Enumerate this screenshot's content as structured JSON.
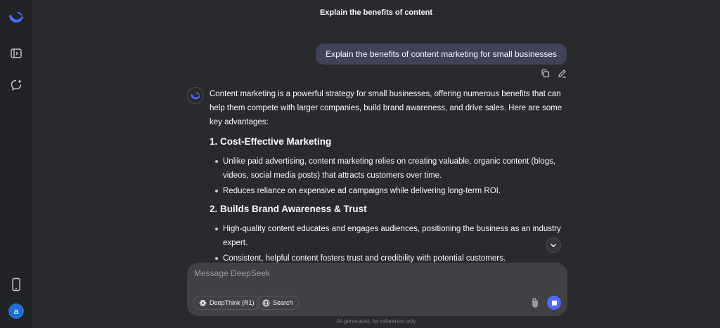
{
  "header": {
    "title": "Explain the benefits of content"
  },
  "sidebar": {
    "icons": [
      "deepseek-logo-icon",
      "open-sidebar-icon",
      "new-chat-icon",
      "mobile-app-icon"
    ],
    "avatar_letter": "a"
  },
  "user_message": {
    "text": "Explain the benefits of content marketing for small businesses"
  },
  "assistant": {
    "intro": "Content marketing is a powerful strategy for small businesses, offering numerous benefits that can help them compete with larger companies, build brand awareness, and drive sales. Here are some key advantages:",
    "sections": [
      {
        "heading": "1. Cost-Effective Marketing",
        "bullets": [
          "Unlike paid advertising, content marketing relies on creating valuable, organic content (blogs, videos, social media posts) that attracts customers over time.",
          "Reduces reliance on expensive ad campaigns while delivering long-term ROI."
        ]
      },
      {
        "heading": "2. Builds Brand Awareness & Trust",
        "bullets": [
          "High-quality content educates and engages audiences, positioning the business as an industry expert.",
          "Consistent, helpful content fosters trust and credibility with potential customers."
        ]
      }
    ]
  },
  "composer": {
    "placeholder": "Message DeepSeek",
    "deepthink_label": "DeepThink (R1)",
    "search_label": "Search"
  },
  "footer": {
    "note": "AI-generated, for reference only"
  },
  "colors": {
    "accent": "#4d6bfe",
    "background": "#292a2d",
    "sidebar": "#212327",
    "bubble": "#414158"
  }
}
